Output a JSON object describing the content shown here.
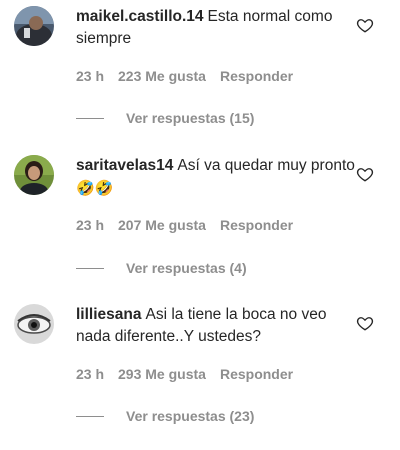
{
  "comments": [
    {
      "username": "maikel.castillo.14",
      "text": "Esta normal como siempre",
      "time": "23 h",
      "likes": "223 Me gusta",
      "reply_label": "Responder",
      "view_replies": "Ver respuestas (15)"
    },
    {
      "username": "saritavelas14",
      "text": "Así va quedar muy pronto",
      "emojis": "🤣🤣",
      "time": "23 h",
      "likes": "207 Me gusta",
      "reply_label": "Responder",
      "view_replies": "Ver respuestas (4)"
    },
    {
      "username": "lilliesana",
      "text": "Asi la tiene la boca no veo nada diferente..Y ustedes?",
      "time": "23 h",
      "likes": "293 Me gusta",
      "reply_label": "Responder",
      "view_replies": "Ver respuestas (23)"
    }
  ],
  "icons": {
    "like": "heart-outline-icon"
  },
  "colors": {
    "text": "#262626",
    "secondary": "#8e8e8e"
  }
}
